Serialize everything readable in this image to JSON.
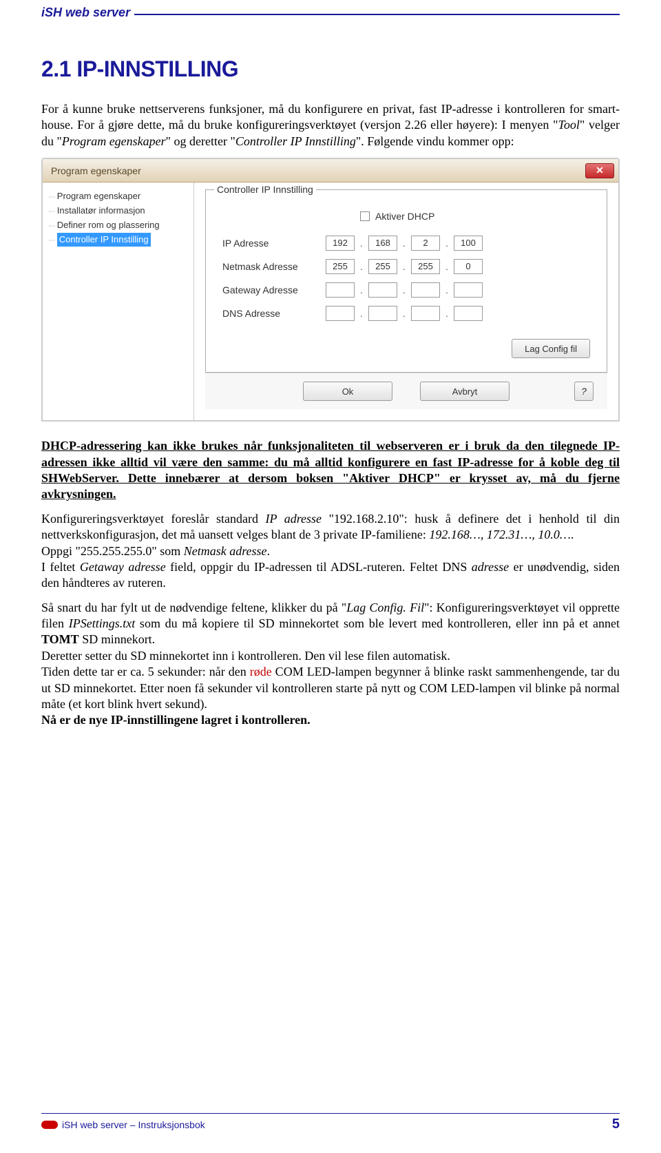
{
  "header": {
    "label": "iSH web server"
  },
  "section": {
    "title": "2.1 IP-INNSTILLING"
  },
  "intro": {
    "p1a": "For å kunne bruke nettserverens funksjoner, må du konfigurere en privat, fast IP-adresse i kontrolleren for smart-house. ",
    "p1b": " For å gjøre dette, må du bruke konfigureringsverktøyet (versjon 2.26 eller høyere):  I menyen \"",
    "p1c": "Tool",
    "p1d": "\" velger du \"",
    "p1e": "Program egenskaper",
    "p1f": "\" og deretter \"",
    "p1g": "Controller IP Innstilling",
    "p1h": "\". Følgende vindu kommer opp:"
  },
  "dialog": {
    "title": "Program egenskaper",
    "tree": {
      "i1": "Program egenskaper",
      "i2": "Installatør informasjon",
      "i3": "Definer rom og plassering",
      "i4": "Controller IP Innstilling"
    },
    "legend": "Controller IP Innstilling",
    "dhcp_label": "Aktiver DHCP",
    "rows": {
      "ip": {
        "label": "IP Adresse",
        "v": [
          "192",
          "168",
          "2",
          "100"
        ]
      },
      "netmask": {
        "label": "Netmask Adresse",
        "v": [
          "255",
          "255",
          "255",
          "0"
        ]
      },
      "gateway": {
        "label": "Gateway Adresse",
        "v": [
          "",
          "",
          "",
          ""
        ]
      },
      "dns": {
        "label": "DNS Adresse",
        "v": [
          "",
          "",
          "",
          ""
        ]
      }
    },
    "btn_lag": "Lag Config fil",
    "btn_ok": "Ok",
    "btn_cancel": "Avbryt",
    "btn_help": "?"
  },
  "body": {
    "bold1": "DHCP-adressering kan ikke brukes når funksjonaliteten til webserveren er i bruk da den tilegnede IP-adressen ikke alltid vil være den samme: du må alltid konfigurere en fast IP-adresse for å koble deg til SHWebServer. Dette innebærer at dersom boksen \"Aktiver DHCP\" er krysset av, må du fjerne avkrysningen.",
    "p2a": "Konfigureringsverktøyet foreslår standard ",
    "p2b": "IP adresse",
    "p2c": " \"192.168.2.10\": husk å definere det i henhold til din nettverkskonfigurasjon, det må uansett velges blant de 3 private IP-familiene: ",
    "p2d": "192.168…, 172.31…, 10.0…",
    "p2e": ".",
    "p3a": "Oppgi \"255.255.255.0\" som ",
    "p3b": "Netmask adresse",
    "p3c": ".",
    "p4a": "I feltet ",
    "p4b": "Getaway adresse",
    "p4c": " field, oppgir du IP-adressen til ADSL-ruteren. Feltet DNS ",
    "p4d": "adresse",
    "p4e": " er unødvendig, siden den håndteres av ruteren.",
    "p5a": "Så snart du har fylt ut de nødvendige feltene, klikker du på \"",
    "p5b": "Lag Config. Fil",
    "p5c": "\": Konfigureringsverktøyet vil opprette filen ",
    "p5d": "IPSettings.txt",
    "p5e": " som du må kopiere til SD minnekortet som ble levert med kontrolleren, eller inn på et annet ",
    "p5f": "TOMT",
    "p5g": " SD minnekort.",
    "p6": "Deretter setter du SD minnekortet inn i kontrolleren. Den vil lese filen automatisk.",
    "p7a": "Tiden dette tar er ca. 5 sekunder: når den ",
    "p7b": "røde",
    "p7c": " COM LED-lampen begynner å blinke raskt sammenhengende, tar du ut SD minnekortet. Etter noen få sekunder vil kontrolleren starte på nytt og COM LED-lampen vil blinke på normal måte (et kort blink hvert sekund).",
    "bold2": "Nå er de nye IP-innstillingene lagret i kontrolleren."
  },
  "footer": {
    "text": "iSH web server – Instruksjonsbok",
    "page": "5"
  }
}
